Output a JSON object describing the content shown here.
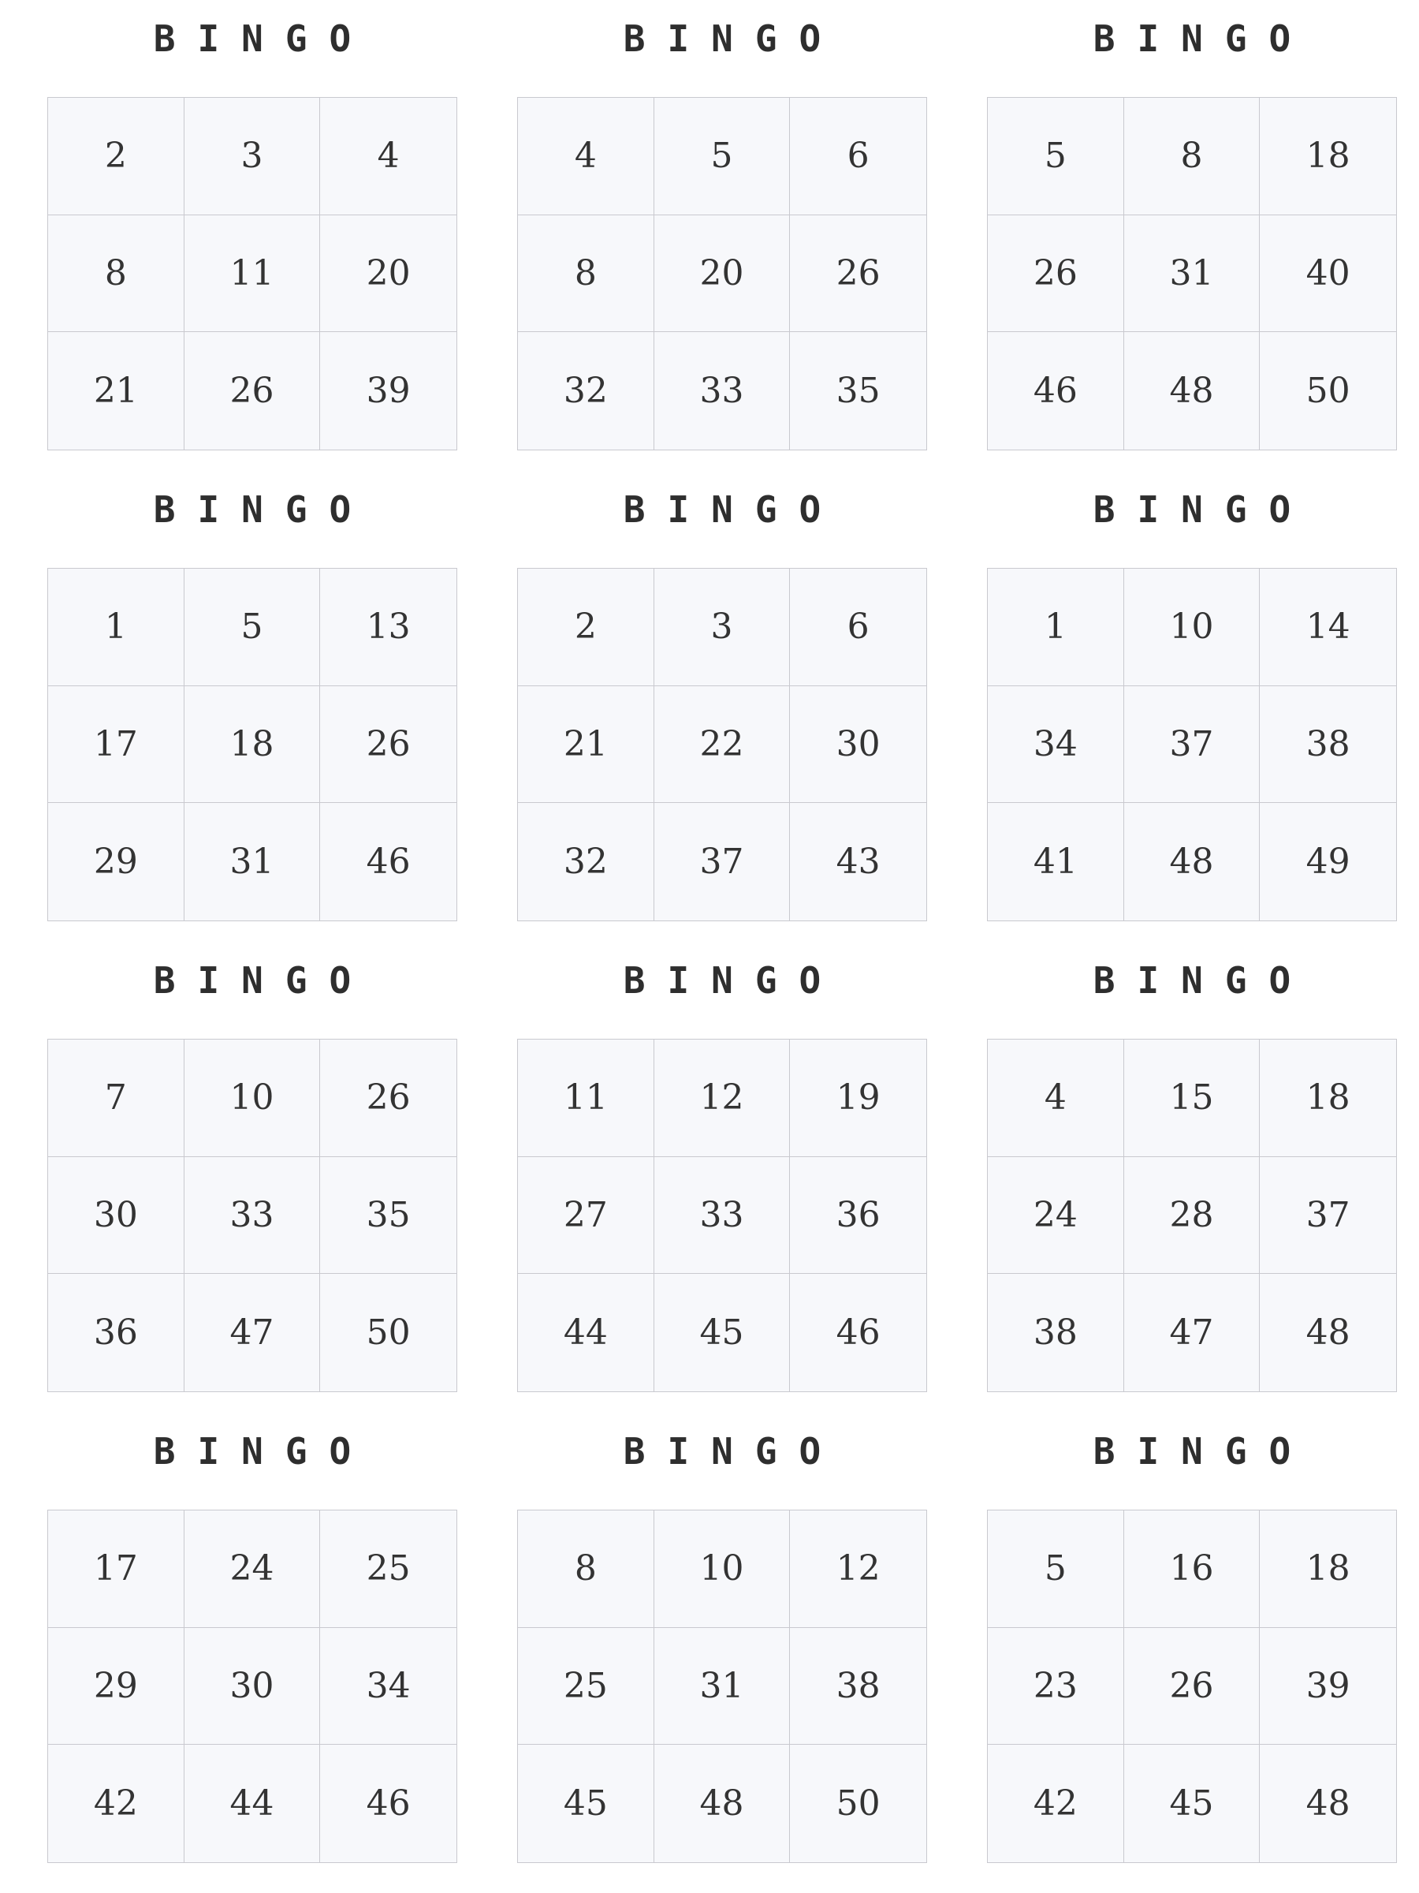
{
  "colors": {
    "background": "#ffffff",
    "cell_fill": "#f7f8fb",
    "grid_line": "#c9c9cf",
    "text": "#333333"
  },
  "cards": [
    {
      "header": "BINGO",
      "numbers": [
        "2",
        "3",
        "4",
        "8",
        "11",
        "20",
        "21",
        "26",
        "39"
      ]
    },
    {
      "header": "BINGO",
      "numbers": [
        "4",
        "5",
        "6",
        "8",
        "20",
        "26",
        "32",
        "33",
        "35"
      ]
    },
    {
      "header": "BINGO",
      "numbers": [
        "5",
        "8",
        "18",
        "26",
        "31",
        "40",
        "46",
        "48",
        "50"
      ]
    },
    {
      "header": "BINGO",
      "numbers": [
        "1",
        "5",
        "13",
        "17",
        "18",
        "26",
        "29",
        "31",
        "46"
      ]
    },
    {
      "header": "BINGO",
      "numbers": [
        "2",
        "3",
        "6",
        "21",
        "22",
        "30",
        "32",
        "37",
        "43"
      ]
    },
    {
      "header": "BINGO",
      "numbers": [
        "1",
        "10",
        "14",
        "34",
        "37",
        "38",
        "41",
        "48",
        "49"
      ]
    },
    {
      "header": "BINGO",
      "numbers": [
        "7",
        "10",
        "26",
        "30",
        "33",
        "35",
        "36",
        "47",
        "50"
      ]
    },
    {
      "header": "BINGO",
      "numbers": [
        "11",
        "12",
        "19",
        "27",
        "33",
        "36",
        "44",
        "45",
        "46"
      ]
    },
    {
      "header": "BINGO",
      "numbers": [
        "4",
        "15",
        "18",
        "24",
        "28",
        "37",
        "38",
        "47",
        "48"
      ]
    },
    {
      "header": "BINGO",
      "numbers": [
        "17",
        "24",
        "25",
        "29",
        "30",
        "34",
        "42",
        "44",
        "46"
      ]
    },
    {
      "header": "BINGO",
      "numbers": [
        "8",
        "10",
        "12",
        "25",
        "31",
        "38",
        "45",
        "48",
        "50"
      ]
    },
    {
      "header": "BINGO",
      "numbers": [
        "5",
        "16",
        "18",
        "23",
        "26",
        "39",
        "42",
        "45",
        "48"
      ]
    }
  ]
}
